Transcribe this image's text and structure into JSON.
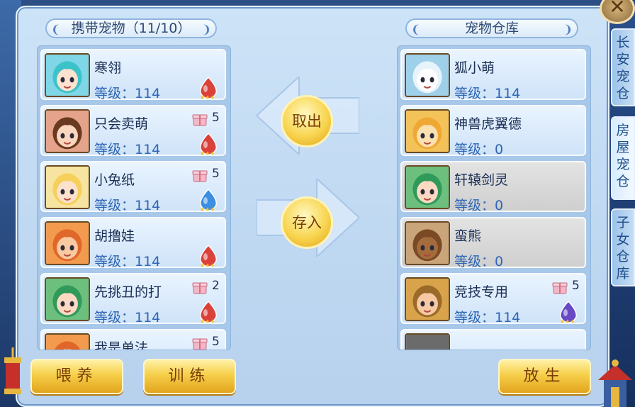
{
  "left_panel": {
    "title": "携带宠物（11/10）",
    "pets": [
      {
        "name": "寒翎",
        "level": "等级：114",
        "gift": "",
        "gem": "red",
        "portrait": "teal"
      },
      {
        "name": "只会卖萌",
        "level": "等级：114",
        "gift": "5",
        "gem": "red",
        "portrait": "brown"
      },
      {
        "name": "小兔纸",
        "level": "等级：114",
        "gift": "5",
        "gem": "blue",
        "portrait": "blonde"
      },
      {
        "name": "胡撸娃",
        "level": "等级：114",
        "gift": "",
        "gem": "red",
        "portrait": "orange"
      },
      {
        "name": "先挑丑的打",
        "level": "等级：114",
        "gift": "2",
        "gem": "red",
        "portrait": "green"
      },
      {
        "name": "我是单法",
        "level": "",
        "gift": "5",
        "gem": "",
        "portrait": "orange"
      }
    ]
  },
  "right_panel": {
    "title": "宠物仓库",
    "pets": [
      {
        "name": "狐小萌",
        "level": "等级：114",
        "gift": "",
        "gem": "",
        "portrait": "white",
        "grey": false
      },
      {
        "name": "神兽虎翼德",
        "level": "等级：0",
        "gift": "",
        "gem": "",
        "portrait": "tiger",
        "grey": false
      },
      {
        "name": "轩辕剑灵",
        "level": "等级：0",
        "gift": "",
        "gem": "",
        "portrait": "green",
        "grey": true
      },
      {
        "name": "蛮熊",
        "level": "等级：0",
        "gift": "",
        "gem": "",
        "portrait": "bear",
        "grey": true
      },
      {
        "name": "竞技专用",
        "level": "等级：114",
        "gift": "5",
        "gem": "purple",
        "portrait": "warrior",
        "grey": false
      },
      {
        "name": "",
        "level": "",
        "gift": "",
        "gem": "",
        "portrait": "empty",
        "grey": false
      }
    ]
  },
  "actions": {
    "take_out": "取出",
    "store": "存入",
    "feed": "喂养",
    "train": "训练",
    "release": "放生"
  },
  "side_tabs": [
    {
      "label": "长安宠仓",
      "active": false
    },
    {
      "label": "房屋宠仓",
      "active": true
    },
    {
      "label": "子女仓库",
      "active": false
    }
  ],
  "close_label": "✕",
  "colors": {
    "panel": "#c5dcf3",
    "gold_button": "#f6cf4a",
    "level_text": "#2e66b3",
    "name_text": "#1b2f55"
  },
  "icons": {
    "gift": "gift-icon",
    "gem_red": "red-gem-icon",
    "gem_blue": "blue-gem-icon",
    "gem_purple": "purple-gem-icon",
    "close": "close-icon"
  }
}
